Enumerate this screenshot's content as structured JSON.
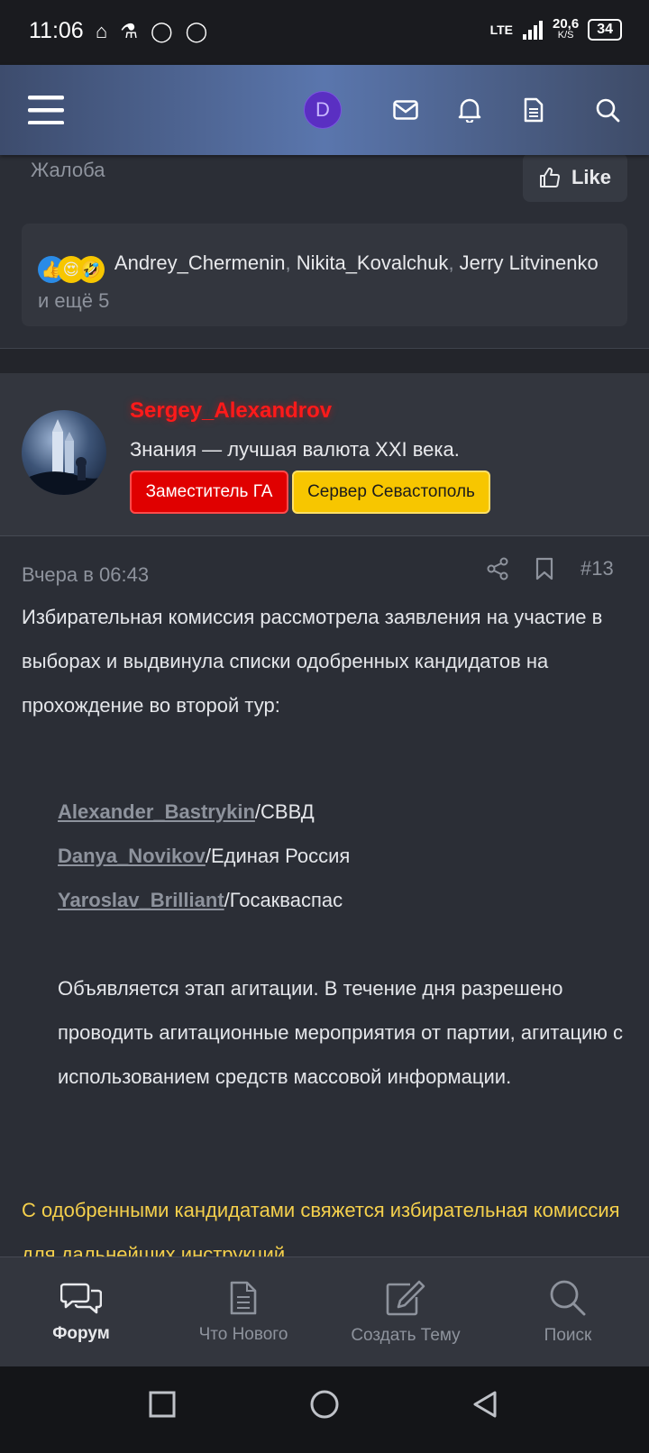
{
  "status": {
    "time": "11:06",
    "network": "LTE",
    "speed_value": "20,6",
    "speed_unit": "K/S",
    "battery": "34"
  },
  "topnav": {
    "avatar_letter": "D"
  },
  "previous_post": {
    "complaint_label": "Жалоба",
    "like_label": "Like",
    "reactions": {
      "user1": "Andrey_Chermenin",
      "user2": "Nikita_Kovalchuk",
      "user3": "Jerry Litvinenko",
      "more": "и ещё 5"
    }
  },
  "post": {
    "author": "Sergey_Alexandrov",
    "user_title": "Знания — лучшая валюта XXI века.",
    "badge1": "Заместитель ГА",
    "badge2": "Сервер Севастополь",
    "date": "Вчера в 06:43",
    "number": "#13",
    "intro": "Избирательная комиссия рассмотрела заявления на участие в выборах и выдвинула списки одобренных кандидатов на прохождение во второй тур:",
    "candidates": [
      {
        "name": "Alexander_Bastrykin",
        "party": "/СВВД"
      },
      {
        "name": "Danya_Novikov",
        "party": "/Единая Россия"
      },
      {
        "name": "Yaroslav_Brilliant",
        "party": "/Госакваспас"
      }
    ],
    "agitation": "Объявляется этап агитации. В течение дня разрешено проводить агитационные мероприятия от партии, агитацию с использованием средств массовой информации.",
    "highlight": "С одобренными кандидатами свяжется избирательная комиссия для дальнейших инструкций."
  },
  "bottomnav": {
    "forum": "Форум",
    "whats_new": "Что Нового",
    "create_topic": "Создать Тему",
    "search": "Поиск"
  }
}
